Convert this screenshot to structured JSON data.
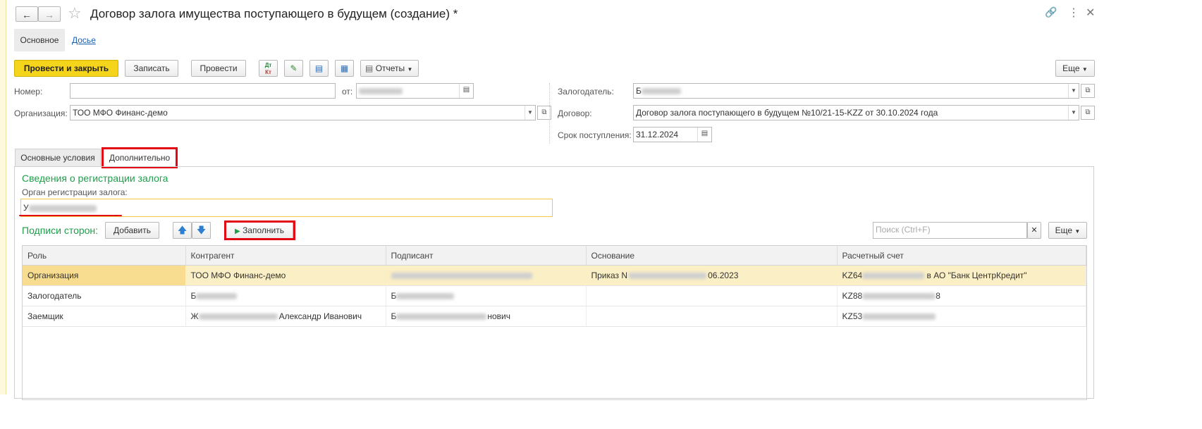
{
  "window": {
    "title": "Договор залога имущества поступающего в будущем (создание) *"
  },
  "nav_tabs": [
    {
      "label": "Основное"
    },
    {
      "label": "Досье"
    }
  ],
  "toolbar": {
    "post_close_label": "Провести и закрыть",
    "save_label": "Записать",
    "post_label": "Провести",
    "reports_label": "Отчеты",
    "more_label": "Еще"
  },
  "form": {
    "number_label": "Номер:",
    "number_value": "",
    "date_label": "от:",
    "org_label": "Организация:",
    "org_value": "ТОО МФО Финанс-демо",
    "pledger_label": "Залогодатель:",
    "pledger_prefix": "Б",
    "contract_label": "Договор:",
    "contract_value": "Договор залога поступающего в будущем №10/21-15-KZZ от 30.10.2024 года",
    "term_label": "Срок поступления:",
    "term_value": "31.12.2024"
  },
  "inner_tabs": [
    {
      "label": "Основные условия"
    },
    {
      "label": "Дополнительно"
    }
  ],
  "registration": {
    "section_title": "Сведения о регистрации залога",
    "authority_label": "Орган регистрации залога:",
    "authority_prefix": "У"
  },
  "signatures": {
    "section_title": "Подписи сторон:",
    "add_label": "Добавить",
    "fill_label": "Заполнить",
    "search_placeholder": "Поиск (Ctrl+F)",
    "more_label": "Еще",
    "columns": [
      "Роль",
      "Контрагент",
      "Подписант",
      "Основание",
      "Расчетный счет"
    ],
    "rows": [
      {
        "role": "Организация",
        "counterparty": "ТОО МФО Финанс-демо",
        "counterparty_suffix": "",
        "signer_prefix": "",
        "signer_suffix": "",
        "basis_prefix": "Приказ N",
        "basis_suffix": "06.2023",
        "account_prefix": "KZ64",
        "account_suffix": " в АО \"Банк ЦентрКредит\""
      },
      {
        "role": "Залогодатель",
        "counterparty": "Б",
        "counterparty_suffix": "",
        "signer_prefix": "Б",
        "signer_suffix": "",
        "basis_prefix": "",
        "basis_suffix": "",
        "account_prefix": "KZ88",
        "account_suffix": "8"
      },
      {
        "role": "Заемщик",
        "counterparty": "Ж",
        "counterparty_suffix": "Александр Иванович",
        "signer_prefix": "Б",
        "signer_suffix": "нович",
        "basis_prefix": "",
        "basis_suffix": "",
        "account_prefix": "KZ53",
        "account_suffix": ""
      }
    ]
  },
  "colors": {
    "accent_green": "#1e9e4a",
    "primary_button": "#f5d41c",
    "highlight_red": "#e30613",
    "selected_row": "#fbefc5"
  }
}
